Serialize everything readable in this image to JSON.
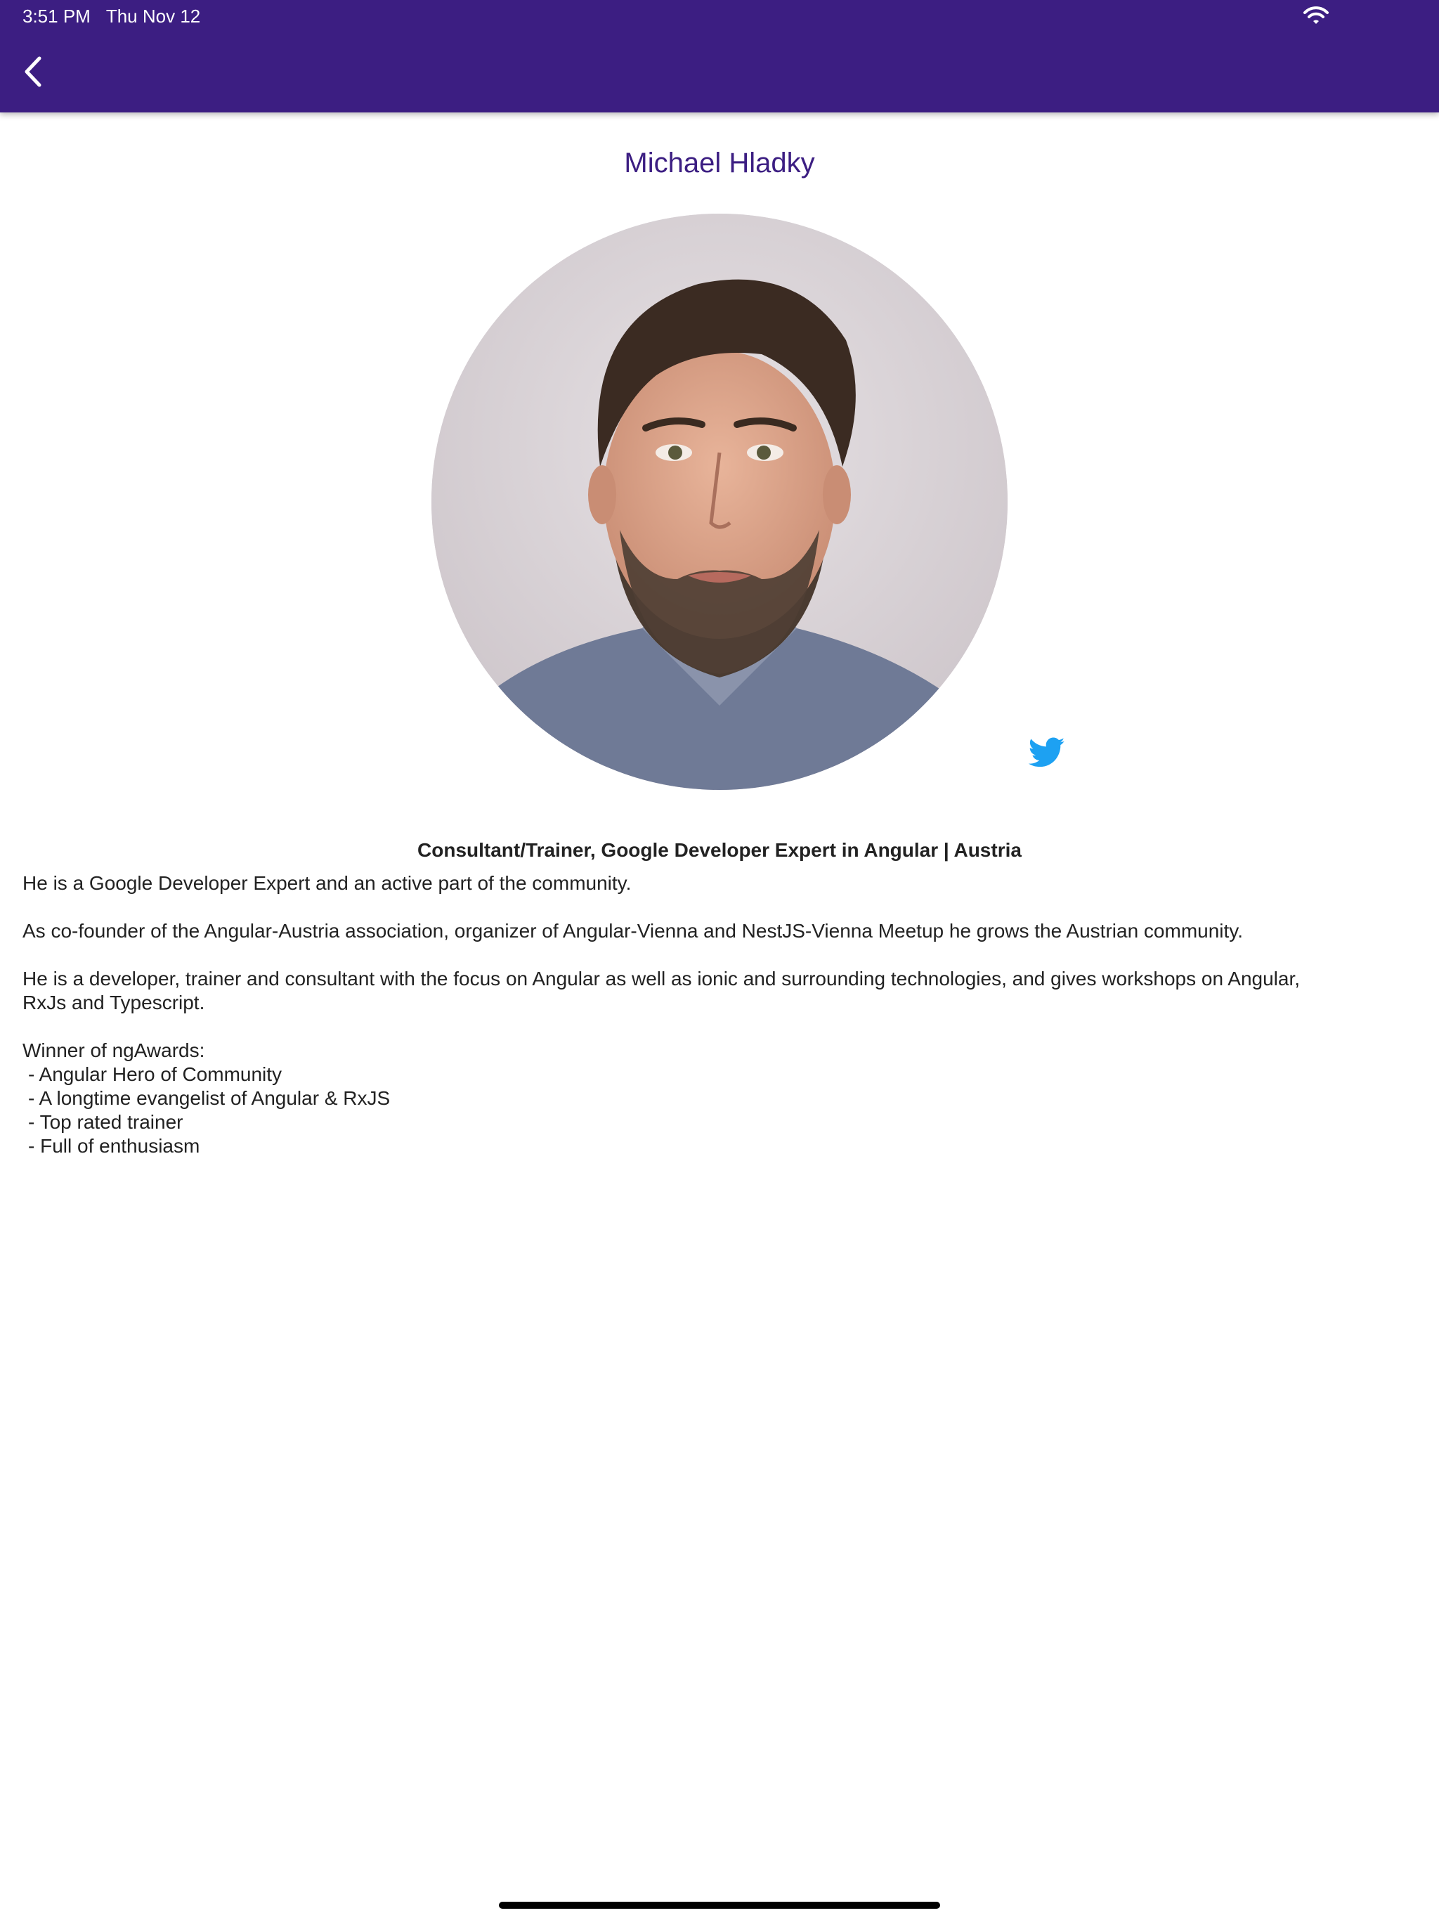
{
  "status_bar": {
    "time": "3:51 PM",
    "date": "Thu Nov 12",
    "wifi_icon": "wifi-icon"
  },
  "toolbar": {
    "back_icon": "chevron-left-icon",
    "color": "#3c1e82"
  },
  "speaker": {
    "name": "Michael Hladky",
    "photo_icon": "speaker-photo",
    "twitter_icon": "twitter-icon",
    "twitter_color": "#1da1f2",
    "headline": "Consultant/Trainer, Google Developer Expert in Angular | Austria"
  },
  "bio": {
    "p1": "He is a Google Developer Expert and an active part of the community.",
    "p2": "As co-founder of the Angular-Austria association, organizer of Angular-Vienna and NestJS-Vienna Meetup he grows the Austrian community.",
    "p3_line1": "He is a developer, trainer and consultant with the focus on Angular as well as ionic and surrounding technologies, and gives workshops on Angular,",
    "p3_line2": "RxJs and Typescript.",
    "awards_title": "Winner of ngAwards:",
    "awards": [
      "- Angular Hero of Community",
      "- A longtime evangelist of Angular & RxJS",
      "- Top rated trainer",
      "- Full of enthusiasm"
    ]
  }
}
